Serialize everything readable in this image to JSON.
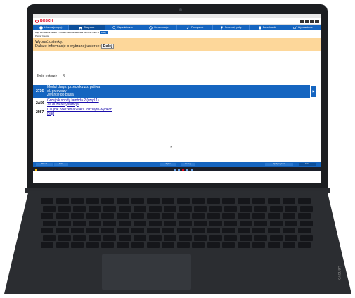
{
  "window_title": "",
  "brand": "BOSCH",
  "vehicle_info": "",
  "nav": [
    {
      "label": "Informacje o poj.",
      "icon": "info-icon"
    },
    {
      "label": "Diagnoza",
      "icon": "car-icon"
    },
    {
      "label": "Wyszukiwanie",
      "icon": "search-icon"
    },
    {
      "label": "Konserwacja",
      "icon": "gear-icon"
    },
    {
      "label": "Podręcznik",
      "icon": "wrench-icon"
    },
    {
      "label": "Schematy połą.",
      "icon": "plug-icon"
    },
    {
      "label": "Dane blanki",
      "icon": "book-icon"
    },
    {
      "label": "Wyposażenie",
      "icon": "link-icon"
    }
  ],
  "breadcrumb": {
    "text": "Błąd sterowania układu 1 / Układ sterowania silnika Motronic ME 7.9",
    "button": "Dalej"
  },
  "subcrumb": "Pomiar błędów",
  "info": {
    "title": "Wybrać usterkę.",
    "line": "Dalsze informacje o wybranej usterce:",
    "button": "Dalej"
  },
  "count": {
    "label": "Ilość usterek",
    "value": "3"
  },
  "faults": [
    {
      "code": "2716",
      "lines": [
        "Moduł diagn. przecieku zb. paliwa",
        "el. grzewczy",
        "Zwarcie do plusa"
      ],
      "selected": true
    },
    {
      "code": "2A56",
      "lines": [
        "Grzejnik sondy lambda 2 (rząd 1)",
        "Za duża rezystancja"
      ],
      "selected": false
    },
    {
      "code": "2987",
      "lines": [
        "Czujnik położenia wałka rozrządu-wydech",
        "Błąd"
      ],
      "selected": false
    }
  ],
  "bottom_buttons": [
    "Wstecz",
    "Dalej",
    "Zapisz",
    "Drukuj",
    "Wyślij zapytanie",
    "Dalej"
  ],
  "laptop_brand": "Lenovo"
}
